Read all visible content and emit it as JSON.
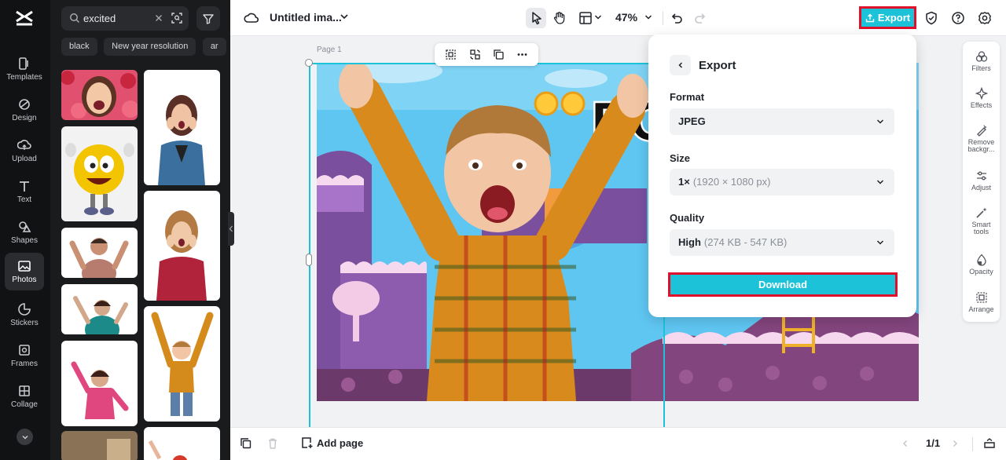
{
  "sidebar": {
    "items": [
      {
        "label": "Templates",
        "icon": "templates-icon"
      },
      {
        "label": "Design",
        "icon": "design-icon"
      },
      {
        "label": "Upload",
        "icon": "upload-icon"
      },
      {
        "label": "Text",
        "icon": "text-icon"
      },
      {
        "label": "Shapes",
        "icon": "shapes-icon"
      },
      {
        "label": "Photos",
        "icon": "photos-icon",
        "active": true
      },
      {
        "label": "Stickers",
        "icon": "stickers-icon"
      },
      {
        "label": "Frames",
        "icon": "frames-icon"
      },
      {
        "label": "Collage",
        "icon": "collage-icon"
      }
    ]
  },
  "search": {
    "value": "excited",
    "chips": [
      "black",
      "New year resolution",
      "ar"
    ]
  },
  "topbar": {
    "title": "Untitled ima...",
    "zoom": "47%",
    "export_label": "Export"
  },
  "canvas": {
    "page_label": "Page 1"
  },
  "right_tools": [
    {
      "label": "Filters",
      "icon": "filters-icon"
    },
    {
      "label": "Effects",
      "icon": "effects-icon"
    },
    {
      "label": "Remove backgr...",
      "icon": "remove-background-icon"
    },
    {
      "label": "Adjust",
      "icon": "adjust-icon"
    },
    {
      "label": "Smart tools",
      "icon": "smart-tools-icon"
    },
    {
      "label": "Opacity",
      "icon": "opacity-icon"
    },
    {
      "label": "Arrange",
      "icon": "arrange-icon"
    }
  ],
  "export_panel": {
    "title": "Export",
    "format_label": "Format",
    "format_value": "JPEG",
    "size_label": "Size",
    "size_value": "1×",
    "size_detail": "(1920 × 1080 px)",
    "quality_label": "Quality",
    "quality_value": "High",
    "quality_detail": "(274 KB - 547 KB)",
    "download_label": "Download"
  },
  "bottombar": {
    "add_page_label": "Add page",
    "pager": "1/1"
  },
  "colors": {
    "accent": "#1cc2d8",
    "highlight": "#e00f2a",
    "rail_bg": "#111213",
    "panel_bg": "#1a1b1d"
  }
}
